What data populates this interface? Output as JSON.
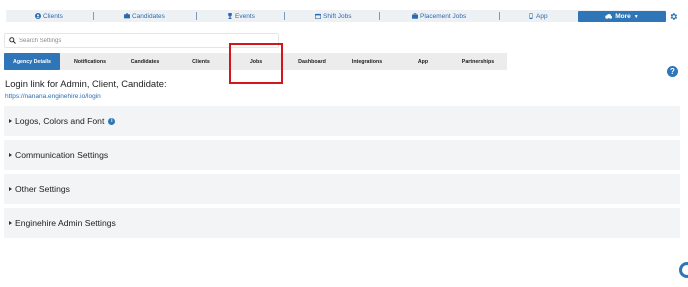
{
  "topnav": {
    "items": [
      {
        "label": "Clients",
        "icon": "user-circle-icon"
      },
      {
        "label": "Candidates",
        "icon": "id-card-icon"
      },
      {
        "label": "Events",
        "icon": "trophy-icon"
      },
      {
        "label": "Shift Jobs",
        "icon": "calendar-icon"
      },
      {
        "label": "Placement Jobs",
        "icon": "briefcase-icon"
      },
      {
        "label": "App",
        "icon": "mobile-icon"
      }
    ],
    "more_label": "More",
    "more_icon": "cloud-icon",
    "settings_icon": "gear-icon"
  },
  "search": {
    "placeholder": "Search Settings"
  },
  "tabs": {
    "items": [
      "Agency Details",
      "Notifications",
      "Candidates",
      "Clients",
      "Jobs",
      "Dashboard",
      "Integrations",
      "App",
      "Partnerships"
    ],
    "active": "Agency Details",
    "highlighted": "Jobs"
  },
  "login": {
    "label": "Login link for Admin, Client, Candidate:",
    "link": "https://nanana.enginehire.io/login"
  },
  "sections": [
    {
      "label": "Logos, Colors and Font",
      "has_info": true
    },
    {
      "label": "Communication Settings",
      "has_info": false
    },
    {
      "label": "Other Settings",
      "has_info": false
    },
    {
      "label": "Enginehire Admin Settings",
      "has_info": false
    }
  ],
  "help_text": "?",
  "info_text": "i",
  "colors": {
    "accent": "#2e76b8",
    "highlight": "#d1171b",
    "panel": "#f3f4f5"
  }
}
